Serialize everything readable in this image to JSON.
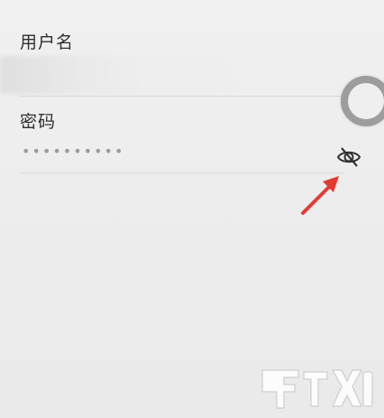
{
  "form": {
    "username_label": "用户名",
    "password_label": "密码",
    "password_mask": "••••••••••",
    "toggle_visibility_icon": "eye-slash-icon"
  },
  "colors": {
    "background": "#efefef",
    "text": "#2f2f2f",
    "underline": "#d8d8d8",
    "arrow": "#e23b32",
    "float_button": "#9d9d9d"
  }
}
